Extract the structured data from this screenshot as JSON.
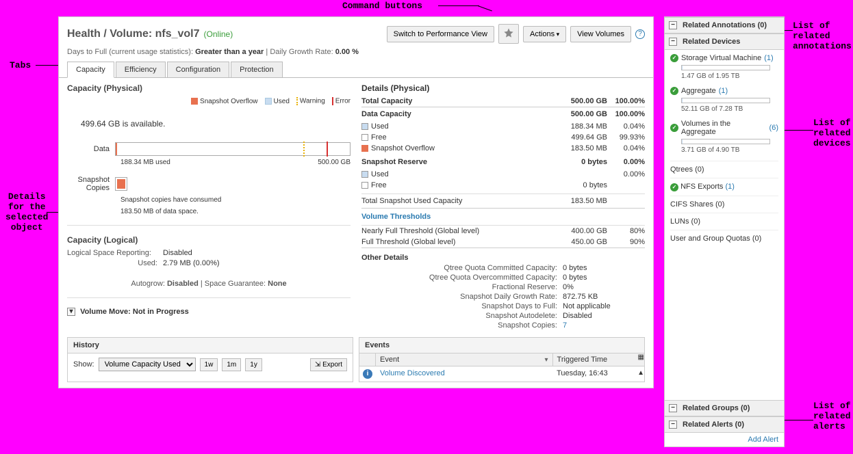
{
  "annotations": {
    "cmd": "Command buttons",
    "tabs": "Tabs",
    "details": "Details\nfor the\nselected\nobject",
    "rel_annot": "List of\nrelated\nannotations",
    "rel_dev": "List of\nrelated\ndevices",
    "rel_groups_alerts": "List of\nrelated\nalerts"
  },
  "header": {
    "title": "Health / Volume: nfs_vol7",
    "status": "(Online)",
    "btn_perf": "Switch to Performance View",
    "btn_actions": "Actions",
    "btn_view": "View Volumes"
  },
  "sub": {
    "days_label": "Days to Full (current usage statistics): ",
    "days_val": "Greater than a year",
    "growth_label": " | Daily Growth Rate: ",
    "growth_val": "0.00 %"
  },
  "tabs": {
    "capacity": "Capacity",
    "efficiency": "Efficiency",
    "configuration": "Configuration",
    "protection": "Protection"
  },
  "cap_phys": {
    "title": "Capacity (Physical)",
    "legend": {
      "ov": "Snapshot Overflow",
      "used": "Used",
      "warn": "Warning",
      "err": "Error"
    },
    "avail": "499.64 GB is available.",
    "data_label": "Data",
    "data_used": "188.34 MB used",
    "data_total": "500.00 GB",
    "snap_label": "Snapshot\nCopies",
    "snap_text1": "Snapshot copies have consumed",
    "snap_text2": "183.50 MB of data space."
  },
  "cap_log": {
    "title": "Capacity (Logical)",
    "k1": "Logical Space Reporting:",
    "v1": "Disabled",
    "k2": "Used:",
    "v2": "2.79 MB (0.00%)",
    "footer1": "Autogrow: ",
    "footer1b": "Disabled",
    "footer_sep": "   |   ",
    "footer2": "Space Guarantee: ",
    "footer2b": "None",
    "vm": "Volume Move: Not in Progress"
  },
  "details": {
    "title": "Details (Physical)",
    "rows": {
      "total": {
        "l": "Total Capacity",
        "v1": "500.00 GB",
        "v2": "100.00%"
      },
      "dc": {
        "l": "Data Capacity",
        "v1": "500.00 GB",
        "v2": "100.00%"
      },
      "dc_used": {
        "l": "Used",
        "v1": "188.34 MB",
        "v2": "0.04%"
      },
      "dc_free": {
        "l": "Free",
        "v1": "499.64 GB",
        "v2": "99.93%"
      },
      "dc_ov": {
        "l": "Snapshot Overflow",
        "v1": "183.50 MB",
        "v2": "0.04%"
      },
      "sr": {
        "l": "Snapshot Reserve",
        "v1": "0 bytes",
        "v2": "0.00%"
      },
      "sr_used": {
        "l": "Used",
        "v1": "",
        "v2": "0.00%"
      },
      "sr_free": {
        "l": "Free",
        "v1": "0 bytes",
        "v2": ""
      },
      "tsuc": {
        "l": "Total Snapshot Used Capacity",
        "v1": "183.50 MB",
        "v2": ""
      }
    },
    "vt": "Volume Thresholds",
    "nf": {
      "l": "Nearly Full Threshold (Global level)",
      "v1": "400.00 GB",
      "v2": "80%"
    },
    "ft": {
      "l": "Full Threshold (Global level)",
      "v1": "450.00 GB",
      "v2": "90%"
    },
    "od_title": "Other Details",
    "od": {
      "qcc": {
        "k": "Qtree Quota Committed Capacity:",
        "v": "0 bytes"
      },
      "qoc": {
        "k": "Qtree Quota Overcommitted Capacity:",
        "v": "0 bytes"
      },
      "fr": {
        "k": "Fractional Reserve:",
        "v": "0%"
      },
      "sdgr": {
        "k": "Snapshot Daily Growth Rate:",
        "v": "872.75 KB"
      },
      "sdtf": {
        "k": "Snapshot Days to Full:",
        "v": "Not applicable"
      },
      "sad": {
        "k": "Snapshot Autodelete:",
        "v": "Disabled"
      },
      "sc": {
        "k": "Snapshot Copies:",
        "v": "7"
      }
    }
  },
  "history": {
    "title": "History",
    "show": "Show:",
    "select": "Volume Capacity Used",
    "b1w": "1w",
    "b1m": "1m",
    "b1y": "1y",
    "export": "Export"
  },
  "events": {
    "title": "Events",
    "col_event": "Event",
    "col_time": "Triggered Time",
    "row_event": "Volume Discovered",
    "row_time": "Tuesday, 16:43"
  },
  "right": {
    "annot": "Related Annotations (0)",
    "dev": "Related Devices",
    "svm_l": "Storage Virtual Machine",
    "svm_c": "(1)",
    "svm_t": "1.47 GB of 1.95 TB",
    "agg_l": "Aggregate",
    "agg_c": "(1)",
    "agg_t": "52.11 GB of 7.28 TB",
    "via_l": "Volumes in the Aggregate",
    "via_c": "(6)",
    "via_t": "3.71 GB of 4.90 TB",
    "qtrees": "Qtrees  (0)",
    "nfs_l": "NFS Exports",
    "nfs_c": "(1)",
    "cifs": "CIFS Shares  (0)",
    "luns": "LUNs  (0)",
    "ugq": "User and Group Quotas  (0)",
    "groups": "Related Groups (0)",
    "alerts": "Related Alerts (0)",
    "add_alert": "Add Alert"
  },
  "chart_data": {
    "type": "bar",
    "title": "Capacity (Physical)",
    "series": [
      {
        "name": "Data",
        "used_mb": 188.34,
        "total_gb": 500.0,
        "warning_pct": 80,
        "error_pct": 90
      }
    ],
    "details": {
      "Total Capacity": {
        "size_gb": 500.0,
        "pct": 100.0
      },
      "Data Capacity": {
        "size_gb": 500.0,
        "pct": 100.0,
        "Used_mb": 188.34,
        "Used_pct": 0.04,
        "Free_gb": 499.64,
        "Free_pct": 99.93,
        "Snapshot_Overflow_mb": 183.5,
        "Snapshot_Overflow_pct": 0.04
      },
      "Snapshot Reserve": {
        "size_bytes": 0,
        "pct": 0.0,
        "Used_pct": 0.0,
        "Free_bytes": 0
      },
      "Total Snapshot Used Capacity_mb": 183.5,
      "Nearly Full Threshold_gb": 400.0,
      "Nearly Full Threshold_pct": 80,
      "Full Threshold_gb": 450.0,
      "Full Threshold_pct": 90
    }
  }
}
